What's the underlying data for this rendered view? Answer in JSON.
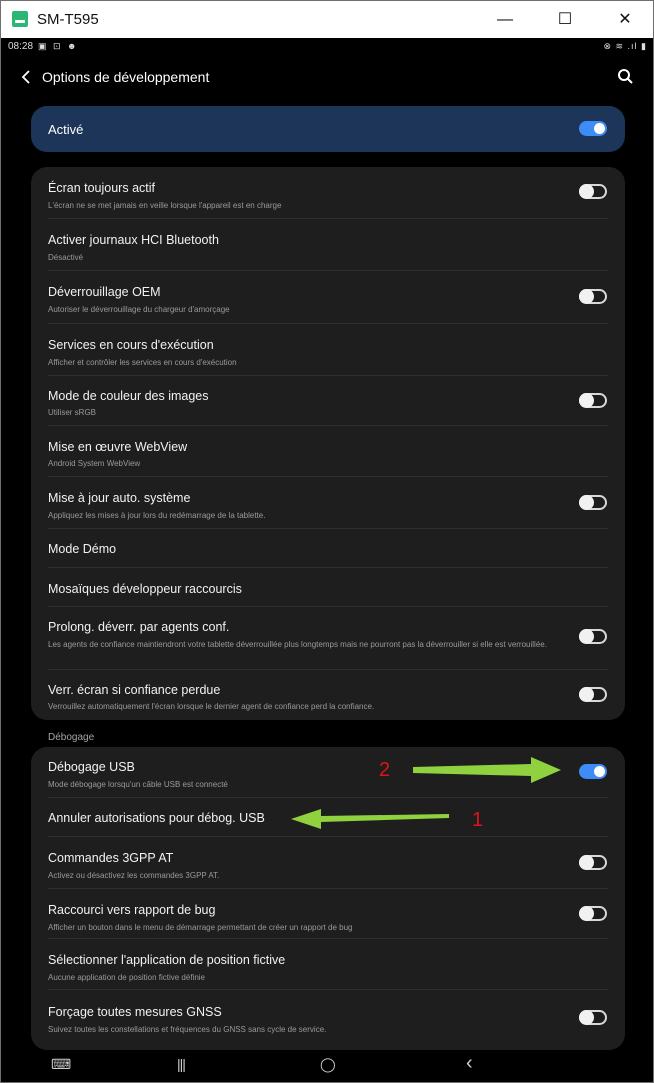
{
  "window": {
    "title": "SM-T595",
    "minimize": "—",
    "maximize": "☐",
    "close": "✕"
  },
  "status": {
    "time": "08:28",
    "left_icons": "▣ ⊡ ☻",
    "right_icons": "⊗ ≋ .ıl ▮"
  },
  "appbar": {
    "title": "Options de développement"
  },
  "master": {
    "label": "Activé",
    "on": true
  },
  "group1": [
    {
      "title": "Écran toujours actif",
      "subtitle": "L'écran ne se met jamais en veille lorsque l'appareil est en charge",
      "toggle": "off"
    },
    {
      "title": "Activer journaux HCI Bluetooth",
      "subtitle": "Désactivé"
    },
    {
      "title": "Déverrouillage OEM",
      "subtitle": "Autoriser le déverrouillage du chargeur d'amorçage",
      "toggle": "off"
    },
    {
      "title": "Services en cours d'exécution",
      "subtitle": "Afficher et contrôler les services en cours d'exécution"
    },
    {
      "title": "Mode de couleur des images",
      "subtitle": "Utiliser sRGB",
      "toggle": "off"
    },
    {
      "title": "Mise en œuvre WebView",
      "subtitle": "Android System WebView"
    },
    {
      "title": "Mise à jour auto. système",
      "subtitle": "Appliquez les mises à jour lors du redémarrage de la tablette.",
      "toggle": "off"
    },
    {
      "title": "Mode Démo"
    },
    {
      "title": "Mosaïques développeur raccourcis"
    },
    {
      "title": "Prolong. déverr. par agents conf.",
      "subtitle": "Les agents de confiance maintiendront votre tablette déverrouillée plus longtemps mais ne pourront pas la déverrouiller si elle est verrouillée.",
      "toggle": "off"
    },
    {
      "title": "Verr. écran si confiance perdue",
      "subtitle": "Verrouillez automatiquement l'écran lorsque le dernier agent de confiance perd la confiance.",
      "toggle": "off"
    }
  ],
  "section": {
    "debug_label": "Débogage"
  },
  "group2": [
    {
      "title": "Débogage USB",
      "subtitle": "Mode débogage lorsqu'un câble USB est connecté",
      "toggle": "on"
    },
    {
      "title": "Annuler autorisations pour débog. USB"
    },
    {
      "title": "Commandes 3GPP AT",
      "subtitle": "Activez ou désactivez les commandes 3GPP AT.",
      "toggle": "off"
    },
    {
      "title": "Raccourci vers rapport de bug",
      "subtitle": "Afficher un bouton dans le menu de démarrage permettant de créer un rapport de bug",
      "toggle": "off"
    },
    {
      "title": "Sélectionner l'application de position fictive",
      "subtitle": "Aucune application de position fictive définie"
    },
    {
      "title": "Forçage toutes mesures GNSS",
      "subtitle": "Suivez toutes les constellations et fréquences du GNSS sans cycle de service.",
      "toggle": "off"
    }
  ],
  "annotations": {
    "one": "1",
    "two": "2",
    "arrow_color": "#8fd13f",
    "number_color": "#e0131b"
  },
  "nav": {
    "recent": "|||",
    "home": "◯",
    "back": "‹",
    "keyboard": "⌨"
  }
}
